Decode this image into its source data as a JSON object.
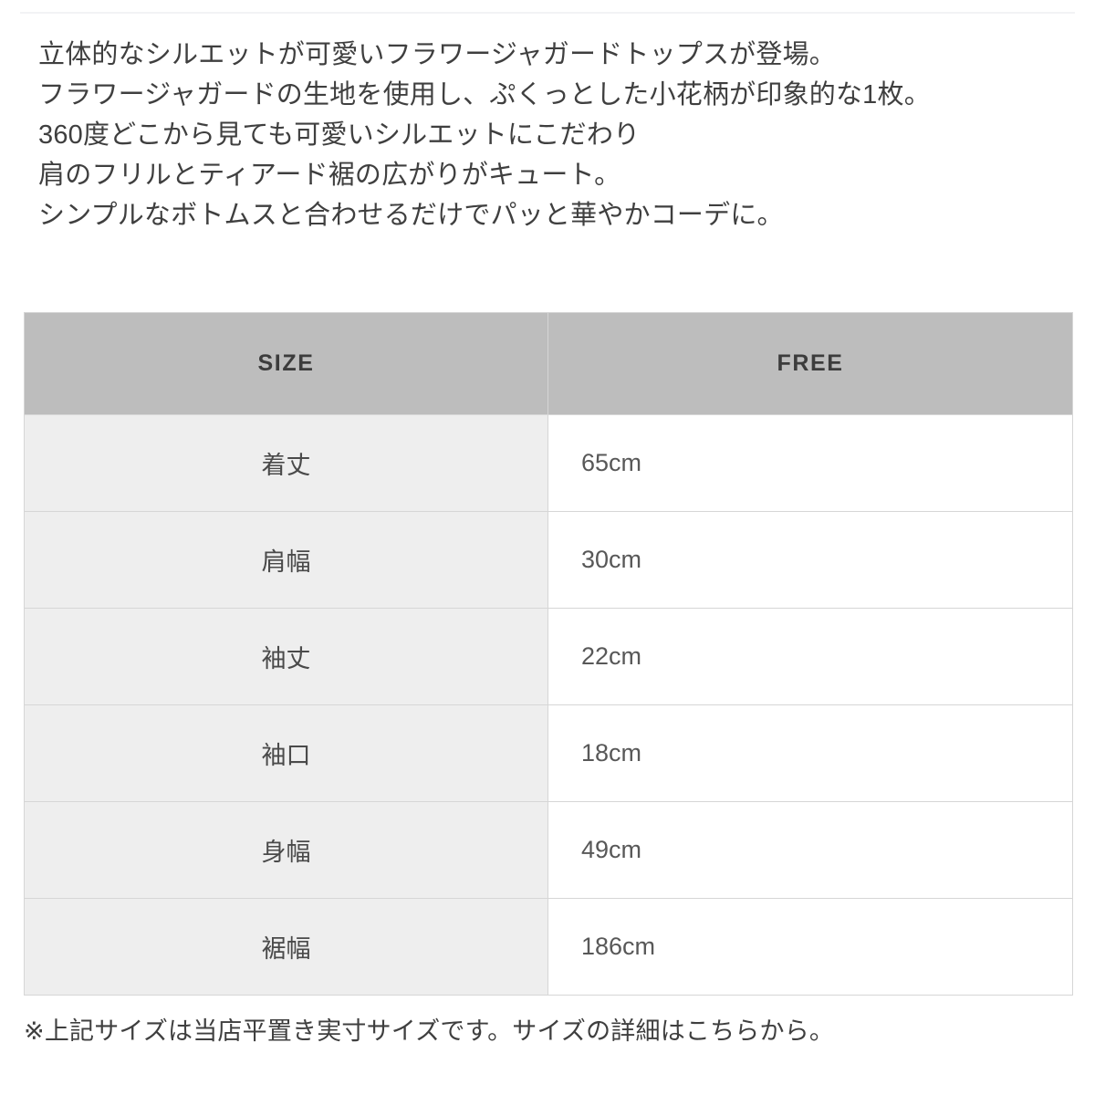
{
  "description": {
    "lines": [
      "立体的なシルエットが可愛いフラワージャガードトップスが登場。",
      "フラワージャガードの生地を使用し、ぷくっとした小花柄が印象的な1枚。",
      "360度どこから見ても可愛いシルエットにこだわり",
      "肩のフリルとティアード裾の広がりがキュート。",
      "シンプルなボトムスと合わせるだけでパッと華やかコーデに。"
    ]
  },
  "size_table": {
    "headers": [
      "SIZE",
      "FREE"
    ],
    "rows": [
      {
        "label": "着丈",
        "value": "65cm"
      },
      {
        "label": "肩幅",
        "value": "30cm"
      },
      {
        "label": "袖丈",
        "value": "22cm"
      },
      {
        "label": "袖口",
        "value": "18cm"
      },
      {
        "label": "身幅",
        "value": "49cm"
      },
      {
        "label": "裾幅",
        "value": "186cm"
      }
    ]
  },
  "footnote": {
    "text": "※上記サイズは当店平置き実寸サイズです。サイズの詳細はこちらから。"
  },
  "colors": {
    "header_background": "#bdbdbd",
    "label_cell_background": "#eeeeee",
    "value_cell_background": "#ffffff",
    "border": "#d6d6d6",
    "body_text": "#3f3f3f",
    "header_text": "#3c3c3c"
  }
}
